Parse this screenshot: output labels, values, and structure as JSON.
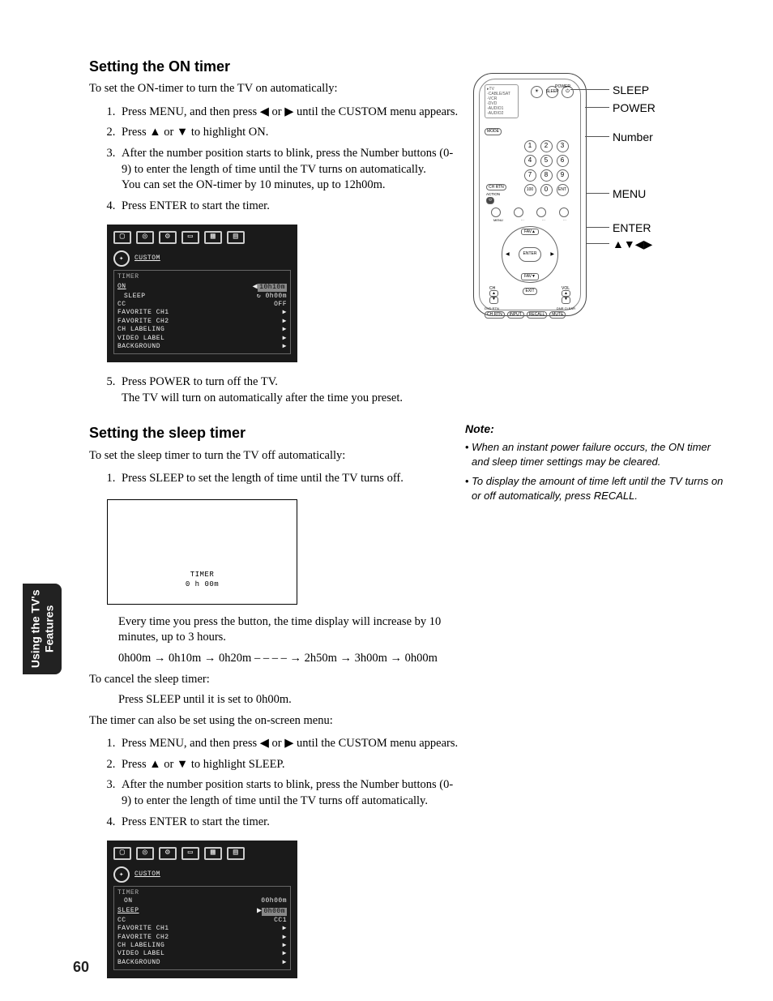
{
  "side_tab": "Using the TV's\nFeatures",
  "page_number": "60",
  "section1": {
    "heading": "Setting the ON timer",
    "intro": "To set the ON-timer to turn the TV on automatically:",
    "steps": [
      "Press MENU, and then press ◀ or ▶ until the CUSTOM menu appears.",
      "Press ▲ or ▼ to highlight ON.",
      "After the number position starts to blink, press the Number buttons (0-9) to enter the length of time until the TV turns on automatically.",
      "Press ENTER to start the timer.",
      "Press POWER to turn off the TV."
    ],
    "step3_sub": "You can set the ON-timer by 10 minutes, up to 12h00m.",
    "step5_sub": "The TV will turn on automatically after the time you preset."
  },
  "tv_menu_on": {
    "title": "CUSTOM",
    "header": "TIMER",
    "on_value_selected": "10h10m",
    "sleep_value": "0h00m",
    "cc_value": "OFF",
    "items": [
      "ON",
      "SLEEP",
      "CC",
      "FAVORITE CH1",
      "FAVORITE CH2",
      "CH LABELING",
      "VIDEO LABEL",
      "BACKGROUND"
    ]
  },
  "section2": {
    "heading": "Setting the sleep timer",
    "intro": "To set the sleep timer to turn the TV off automatically:",
    "step1": "Press SLEEP to set the length of time until the TV turns off.",
    "timer_display_label": "TIMER",
    "timer_display_value": "0 h 00m",
    "after_box": "Every time you press the button, the time display will increase by 10 minutes, up to 3 hours.",
    "sequence": "0h00m → 0h10m → 0h20m – – – – → 2h50m → 3h00m → 0h00m",
    "cancel_intro": "To cancel the sleep timer:",
    "cancel_step": "Press SLEEP until it is set to 0h00m.",
    "osd_intro": "The timer can also be set using the on-screen menu:",
    "osd_steps": [
      "Press MENU, and then press ◀ or ▶ until the CUSTOM menu appears.",
      "Press ▲ or ▼ to highlight SLEEP.",
      "After the number position starts to blink, press the Number buttons (0-9) to enter the length of time until the TV turns off automatically.",
      "Press ENTER to start the timer."
    ]
  },
  "tv_menu_sleep": {
    "title": "CUSTOM",
    "header": "TIMER",
    "on_value": "00h00m",
    "sleep_value_selected": "0h00m",
    "cc_value": "CC1"
  },
  "remote": {
    "modes": [
      "TV",
      "CABLE/SAT",
      "VCR",
      "DVD",
      "AUDIO1",
      "AUDIO2"
    ],
    "mode_btn": "MODE",
    "top": {
      "light": "LIGHT",
      "sleep": "SLEEP",
      "power": "⏻"
    },
    "numbers": [
      "1",
      "2",
      "3",
      "4",
      "5",
      "6",
      "7",
      "8",
      "9",
      "0"
    ],
    "special": {
      "100": "100",
      "chrtn": "CH RTN",
      "action": "ACTION",
      "ent": "ENT"
    },
    "menu_row": {
      "menu": "MENU",
      "input1": "INPUT 1",
      "favorite": "FAVORITE",
      "theater": "THEATER"
    },
    "nav": {
      "enter": "ENTER",
      "fav_up": "FAV▲",
      "fav_down": "FAV▼"
    },
    "side": {
      "ch": "CH",
      "vol": "VOL",
      "exit": "EXIT"
    },
    "bottom": {
      "dvdrtn": "DVD RTN",
      "chrtn2": "CH RTN",
      "input": "INPUT",
      "recall": "RECALL",
      "mute": "MUTE",
      "dnr": "DNR CLEAR"
    },
    "callouts": {
      "sleep": "SLEEP",
      "power": "POWER",
      "number": "Number",
      "menu": "MENU",
      "enter": "ENTER",
      "arrows": "▲▼◀▶"
    }
  },
  "notes": {
    "title": "Note:",
    "items": [
      "When an instant power failure occurs, the ON timer and sleep timer settings may be cleared.",
      "To display the amount of time left until the TV turns on or off automatically, press RECALL."
    ]
  }
}
